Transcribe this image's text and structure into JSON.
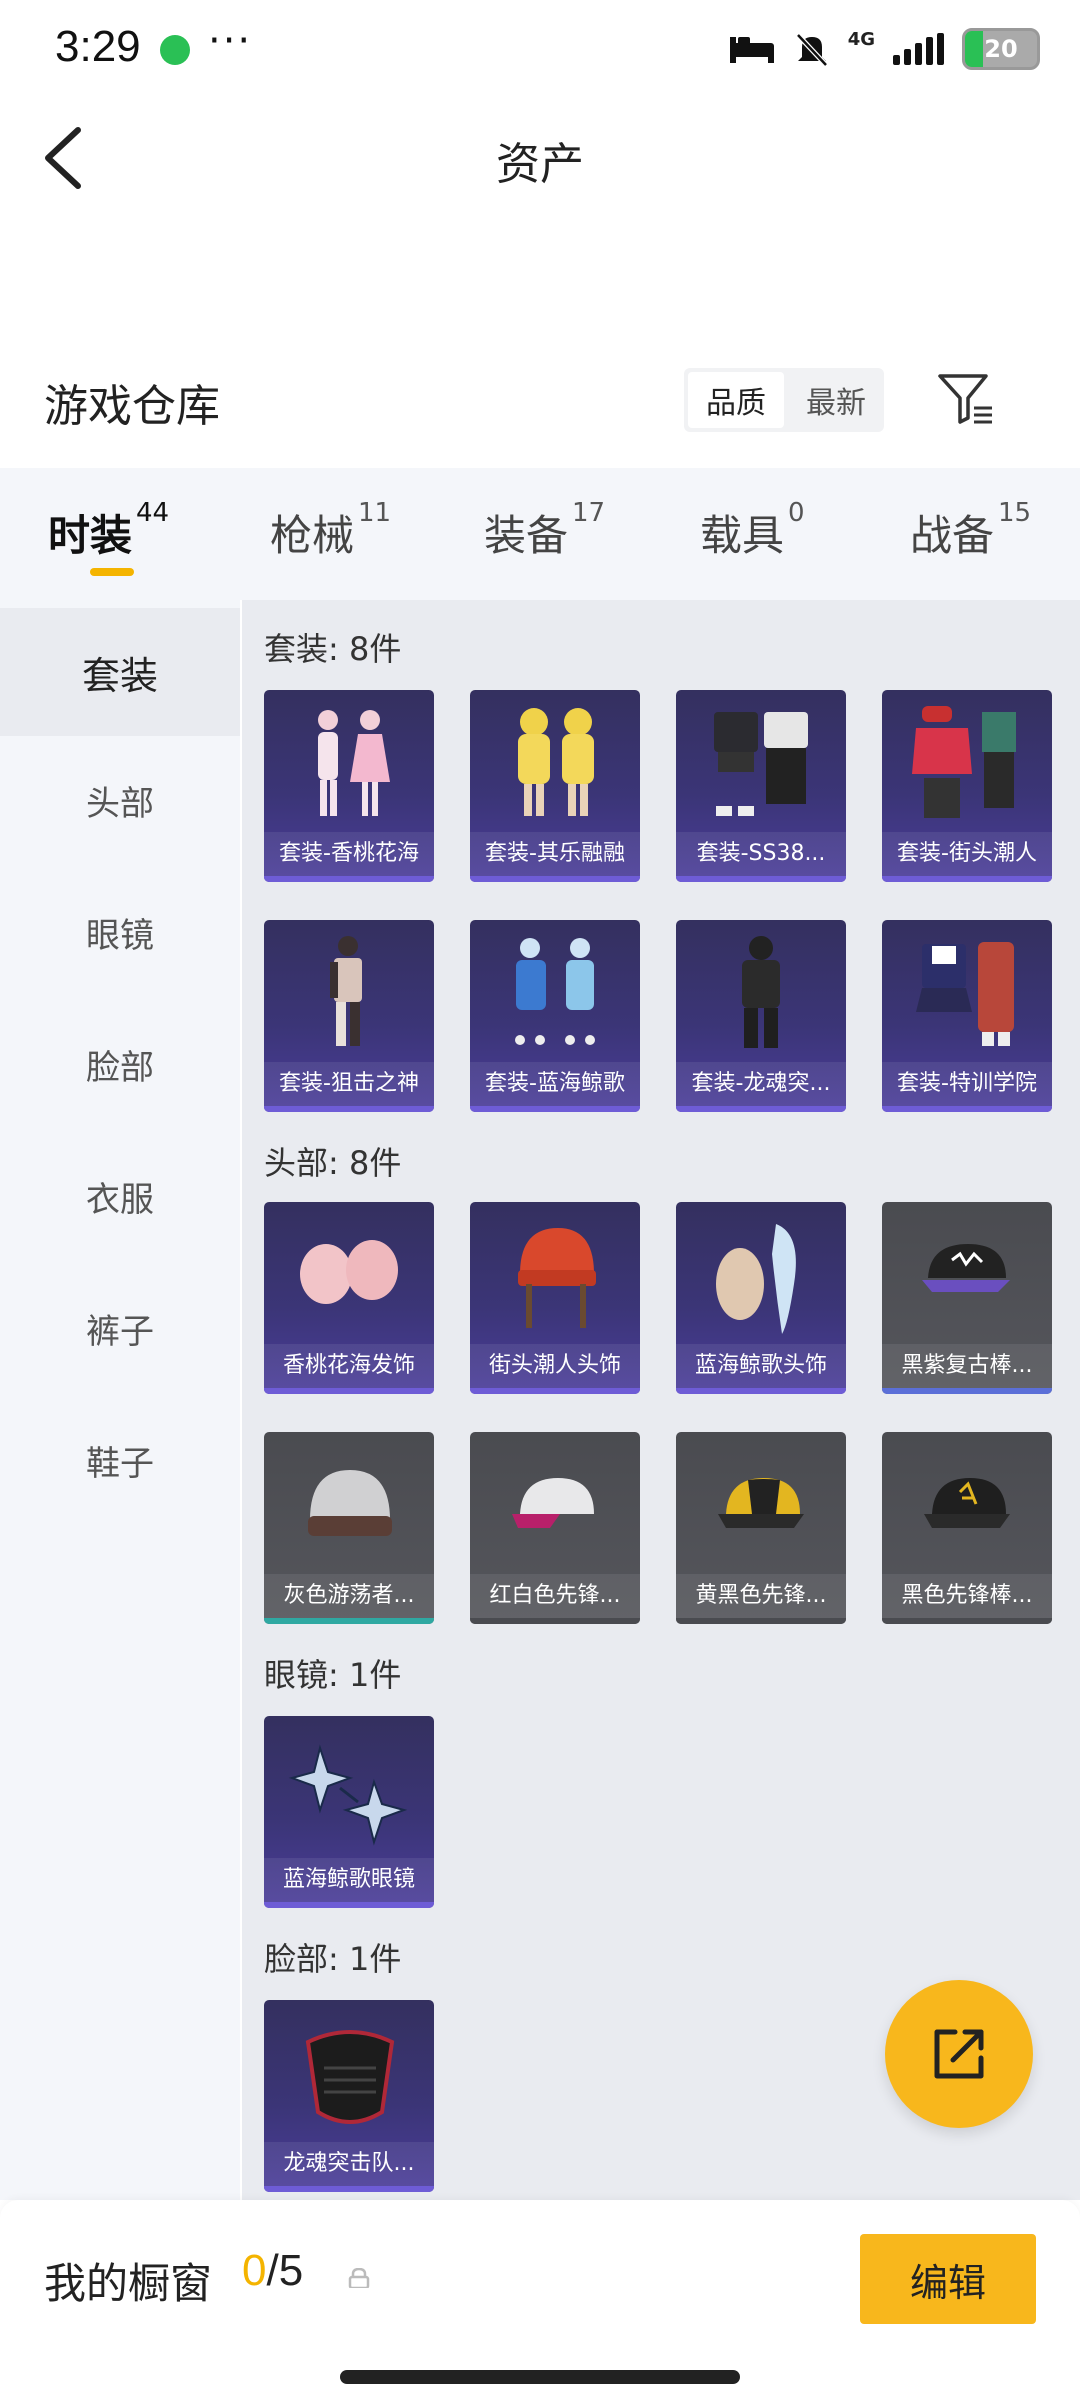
{
  "status_bar": {
    "time": "3:29",
    "more": "···",
    "network": "4G",
    "battery": "20"
  },
  "header": {
    "title": "资产",
    "back_icon": "chevron-left-icon"
  },
  "warehouse": {
    "title": "游戏仓库",
    "sort_options": [
      "品质",
      "最新"
    ],
    "active_sort": "品质",
    "filter_icon": "filter-icon"
  },
  "tabs": [
    {
      "label": "时装",
      "count": "44"
    },
    {
      "label": "枪械",
      "count": "11"
    },
    {
      "label": "装备",
      "count": "17"
    },
    {
      "label": "载具",
      "count": "0"
    },
    {
      "label": "战备",
      "count": "15"
    }
  ],
  "sidebar": [
    "套装",
    "头部",
    "眼镜",
    "脸部",
    "衣服",
    "裤子",
    "鞋子"
  ],
  "sections": [
    {
      "label": "套装: 8件",
      "items": [
        "套装-香桃花海",
        "套装-其乐融融",
        "套装-SS38...",
        "套装-街头潮人",
        "套装-狙击之神",
        "套装-蓝海鲸歌",
        "套装-龙魂突...",
        "套装-特训学院"
      ]
    },
    {
      "label": "头部: 8件",
      "items": [
        "香桃花海发饰",
        "街头潮人头饰",
        "蓝海鲸歌头饰",
        "黑紫复古棒...",
        "灰色游荡者...",
        "红白色先锋...",
        "黄黑色先锋...",
        "黑色先锋棒..."
      ]
    },
    {
      "label": "眼镜: 1件",
      "items": [
        "蓝海鲸歌眼镜"
      ]
    },
    {
      "label": "脸部: 1件",
      "items": [
        "龙魂突击队..."
      ]
    }
  ],
  "bottom": {
    "showcase_label": "我的橱窗",
    "current": "0",
    "separator_total": "/5",
    "edit_label": "编辑"
  },
  "colors": {
    "accent": "#f8b71c",
    "rare_card": "#3b3577",
    "common_card": "#55565c"
  },
  "share_icon": "share-icon"
}
